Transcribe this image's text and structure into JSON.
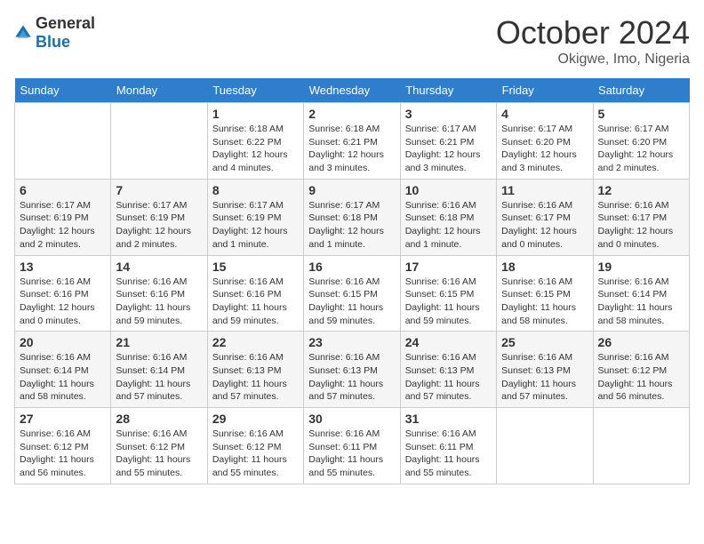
{
  "header": {
    "logo_general": "General",
    "logo_blue": "Blue",
    "month_title": "October 2024",
    "location": "Okigwe, Imo, Nigeria"
  },
  "days_of_week": [
    "Sunday",
    "Monday",
    "Tuesday",
    "Wednesday",
    "Thursday",
    "Friday",
    "Saturday"
  ],
  "weeks": [
    [
      {
        "num": "",
        "info": ""
      },
      {
        "num": "",
        "info": ""
      },
      {
        "num": "1",
        "info": "Sunrise: 6:18 AM\nSunset: 6:22 PM\nDaylight: 12 hours and 4 minutes."
      },
      {
        "num": "2",
        "info": "Sunrise: 6:18 AM\nSunset: 6:21 PM\nDaylight: 12 hours and 3 minutes."
      },
      {
        "num": "3",
        "info": "Sunrise: 6:17 AM\nSunset: 6:21 PM\nDaylight: 12 hours and 3 minutes."
      },
      {
        "num": "4",
        "info": "Sunrise: 6:17 AM\nSunset: 6:20 PM\nDaylight: 12 hours and 3 minutes."
      },
      {
        "num": "5",
        "info": "Sunrise: 6:17 AM\nSunset: 6:20 PM\nDaylight: 12 hours and 2 minutes."
      }
    ],
    [
      {
        "num": "6",
        "info": "Sunrise: 6:17 AM\nSunset: 6:19 PM\nDaylight: 12 hours and 2 minutes."
      },
      {
        "num": "7",
        "info": "Sunrise: 6:17 AM\nSunset: 6:19 PM\nDaylight: 12 hours and 2 minutes."
      },
      {
        "num": "8",
        "info": "Sunrise: 6:17 AM\nSunset: 6:19 PM\nDaylight: 12 hours and 1 minute."
      },
      {
        "num": "9",
        "info": "Sunrise: 6:17 AM\nSunset: 6:18 PM\nDaylight: 12 hours and 1 minute."
      },
      {
        "num": "10",
        "info": "Sunrise: 6:16 AM\nSunset: 6:18 PM\nDaylight: 12 hours and 1 minute."
      },
      {
        "num": "11",
        "info": "Sunrise: 6:16 AM\nSunset: 6:17 PM\nDaylight: 12 hours and 0 minutes."
      },
      {
        "num": "12",
        "info": "Sunrise: 6:16 AM\nSunset: 6:17 PM\nDaylight: 12 hours and 0 minutes."
      }
    ],
    [
      {
        "num": "13",
        "info": "Sunrise: 6:16 AM\nSunset: 6:16 PM\nDaylight: 12 hours and 0 minutes."
      },
      {
        "num": "14",
        "info": "Sunrise: 6:16 AM\nSunset: 6:16 PM\nDaylight: 11 hours and 59 minutes."
      },
      {
        "num": "15",
        "info": "Sunrise: 6:16 AM\nSunset: 6:16 PM\nDaylight: 11 hours and 59 minutes."
      },
      {
        "num": "16",
        "info": "Sunrise: 6:16 AM\nSunset: 6:15 PM\nDaylight: 11 hours and 59 minutes."
      },
      {
        "num": "17",
        "info": "Sunrise: 6:16 AM\nSunset: 6:15 PM\nDaylight: 11 hours and 59 minutes."
      },
      {
        "num": "18",
        "info": "Sunrise: 6:16 AM\nSunset: 6:15 PM\nDaylight: 11 hours and 58 minutes."
      },
      {
        "num": "19",
        "info": "Sunrise: 6:16 AM\nSunset: 6:14 PM\nDaylight: 11 hours and 58 minutes."
      }
    ],
    [
      {
        "num": "20",
        "info": "Sunrise: 6:16 AM\nSunset: 6:14 PM\nDaylight: 11 hours and 58 minutes."
      },
      {
        "num": "21",
        "info": "Sunrise: 6:16 AM\nSunset: 6:14 PM\nDaylight: 11 hours and 57 minutes."
      },
      {
        "num": "22",
        "info": "Sunrise: 6:16 AM\nSunset: 6:13 PM\nDaylight: 11 hours and 57 minutes."
      },
      {
        "num": "23",
        "info": "Sunrise: 6:16 AM\nSunset: 6:13 PM\nDaylight: 11 hours and 57 minutes."
      },
      {
        "num": "24",
        "info": "Sunrise: 6:16 AM\nSunset: 6:13 PM\nDaylight: 11 hours and 57 minutes."
      },
      {
        "num": "25",
        "info": "Sunrise: 6:16 AM\nSunset: 6:13 PM\nDaylight: 11 hours and 57 minutes."
      },
      {
        "num": "26",
        "info": "Sunrise: 6:16 AM\nSunset: 6:12 PM\nDaylight: 11 hours and 56 minutes."
      }
    ],
    [
      {
        "num": "27",
        "info": "Sunrise: 6:16 AM\nSunset: 6:12 PM\nDaylight: 11 hours and 56 minutes."
      },
      {
        "num": "28",
        "info": "Sunrise: 6:16 AM\nSunset: 6:12 PM\nDaylight: 11 hours and 55 minutes."
      },
      {
        "num": "29",
        "info": "Sunrise: 6:16 AM\nSunset: 6:12 PM\nDaylight: 11 hours and 55 minutes."
      },
      {
        "num": "30",
        "info": "Sunrise: 6:16 AM\nSunset: 6:11 PM\nDaylight: 11 hours and 55 minutes."
      },
      {
        "num": "31",
        "info": "Sunrise: 6:16 AM\nSunset: 6:11 PM\nDaylight: 11 hours and 55 minutes."
      },
      {
        "num": "",
        "info": ""
      },
      {
        "num": "",
        "info": ""
      }
    ]
  ]
}
